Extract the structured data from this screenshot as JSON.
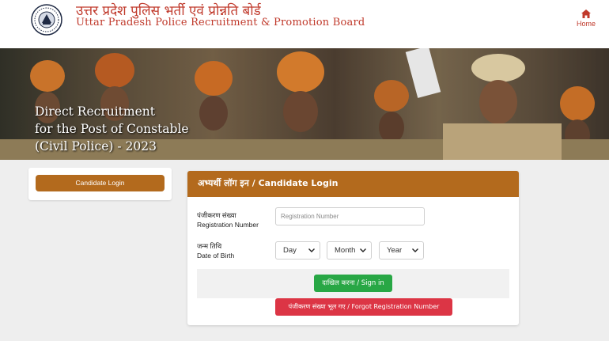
{
  "header": {
    "title_hindi": "उत्तर प्रदेश पुलिस भर्ती एवं प्रोन्नति बोर्ड",
    "title_english": "Uttar Pradesh Police Recruitment & Promotion Board",
    "logo_icon": "upprpb-emblem-icon",
    "home_label": "Home",
    "home_icon": "home-icon"
  },
  "banner": {
    "line1": "Direct Recruitment",
    "line2": "for the Post of Constable",
    "line3": "(Civil Police) - 2023"
  },
  "sidebar": {
    "candidate_login_label": "Candidate Login"
  },
  "login": {
    "heading": "अभ्यर्थी लॉग इन / Candidate Login",
    "registration": {
      "label_hindi": "पंजीकरण संख्या",
      "label_english": "Registration Number",
      "placeholder": "Registration Number",
      "value": ""
    },
    "dob": {
      "label_hindi": "जन्म तिथि",
      "label_english": "Date of Birth",
      "day": "Day",
      "month": "Month",
      "year": "Year"
    },
    "signin_label": "दाखिल करना / Sign in",
    "forgot_label": "पंजीकरण संख्या भूल गए / Forgot Registration Number"
  },
  "colors": {
    "brand_red": "#c0392b",
    "accent_brown": "#b36a1d",
    "success_green": "#28a745",
    "danger_red": "#dc3545"
  }
}
